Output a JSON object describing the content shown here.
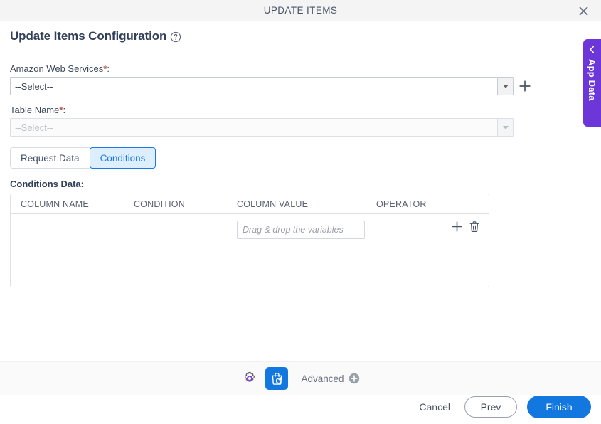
{
  "window": {
    "title": "UPDATE ITEMS",
    "close_icon": "close-icon"
  },
  "header": {
    "title": "Update Items Configuration",
    "help_icon": "help-circle-icon"
  },
  "form": {
    "aws": {
      "label": "Amazon Web Services",
      "required_mark": "*",
      "colon": ":",
      "value": "--Select--",
      "caret_icon": "chevron-down-icon",
      "add_icon": "plus-icon"
    },
    "table_name": {
      "label": "Table Name",
      "required_mark": "*",
      "colon": ":",
      "value": "--Select--",
      "caret_icon": "chevron-down-icon"
    }
  },
  "tabs": [
    {
      "label": "Request Data",
      "active": false
    },
    {
      "label": "Conditions",
      "active": true
    }
  ],
  "conditions": {
    "section_label": "Conditions Data:",
    "columns": [
      "COLUMN NAME",
      "CONDITION",
      "COLUMN VALUE",
      "OPERATOR"
    ],
    "rows": [
      {
        "column_name": "",
        "condition": "",
        "column_value": "",
        "column_value_placeholder": "Drag & drop the variables",
        "operator": "",
        "add_icon": "plus-icon",
        "delete_icon": "trash-icon"
      }
    ]
  },
  "app_data_tab": {
    "label": "App Data",
    "chevron_icon": "chevron-left-icon",
    "color": "#6c36d9"
  },
  "toolbar": {
    "gear_icon": "gear-icon",
    "bag_icon": "shopping-bag-refresh-icon",
    "advanced_label": "Advanced",
    "advanced_icon": "circle-plus-icon"
  },
  "footer": {
    "cancel_label": "Cancel",
    "prev_label": "Prev",
    "finish_label": "Finish",
    "accent_color": "#1277df"
  }
}
